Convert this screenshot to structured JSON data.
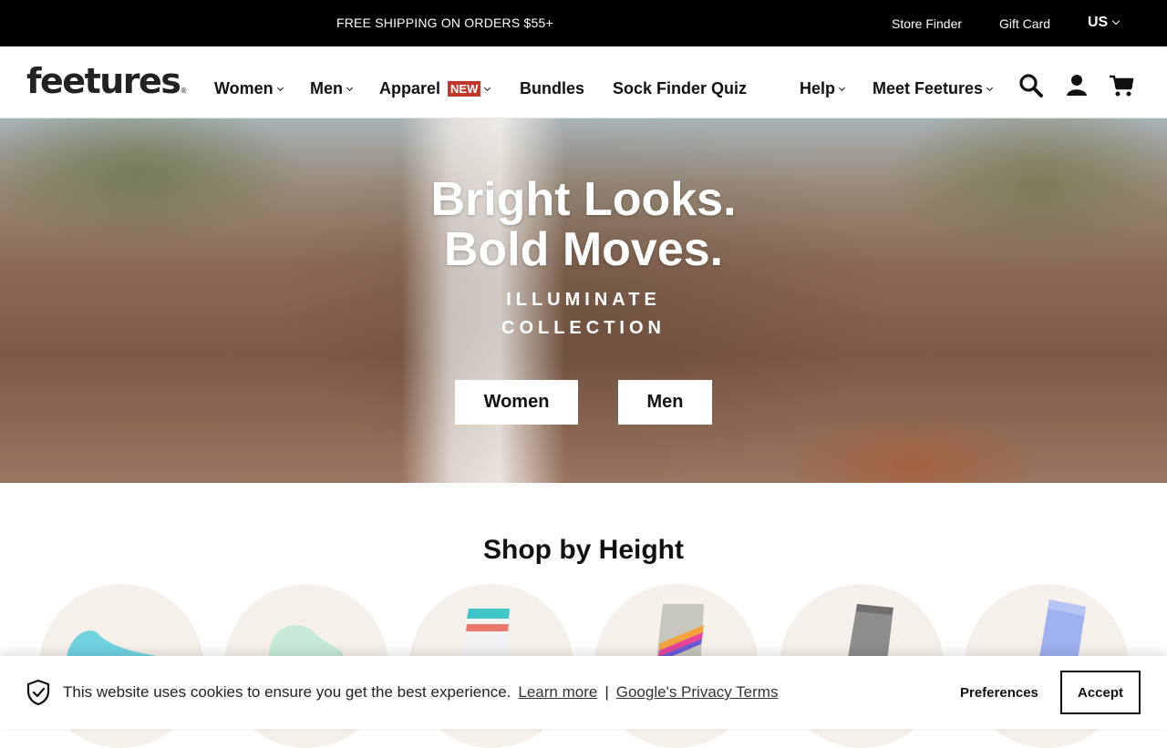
{
  "topbar": {
    "promo": "FREE SHIPPING ON ORDERS $55+",
    "store_finder": "Store Finder",
    "gift_card": "Gift Card",
    "region": "US"
  },
  "nav": {
    "logo_text": "feetures",
    "logo_mark": "®",
    "items": [
      {
        "label": "Women"
      },
      {
        "label": "Men"
      },
      {
        "label": "Apparel",
        "badge": "NEW"
      },
      {
        "label": "Bundles"
      },
      {
        "label": "Sock Finder Quiz"
      },
      {
        "label": "Help"
      },
      {
        "label": "Meet Feetures"
      }
    ],
    "icons": [
      "search-icon",
      "account-icon",
      "cart-icon"
    ]
  },
  "hero": {
    "headline_1": "Bright Looks.",
    "headline_2": "Bold Moves.",
    "sub_1": "ILLUMINATE",
    "sub_2": "COLLECTION",
    "button_women": "Women",
    "button_men": "Men"
  },
  "shop_by_height": {
    "title": "Shop by Height"
  },
  "cookie": {
    "message": "This website uses cookies to ensure you get the best experience.",
    "learn_more": "Learn more",
    "separator": "|",
    "privacy": "Google's Privacy Terms",
    "preferences": "Preferences",
    "accept": "Accept"
  },
  "colors": {
    "topbar_bg": "#000000",
    "badge_bg": "#c0392b",
    "circle_bg": "#f6f0ea"
  }
}
